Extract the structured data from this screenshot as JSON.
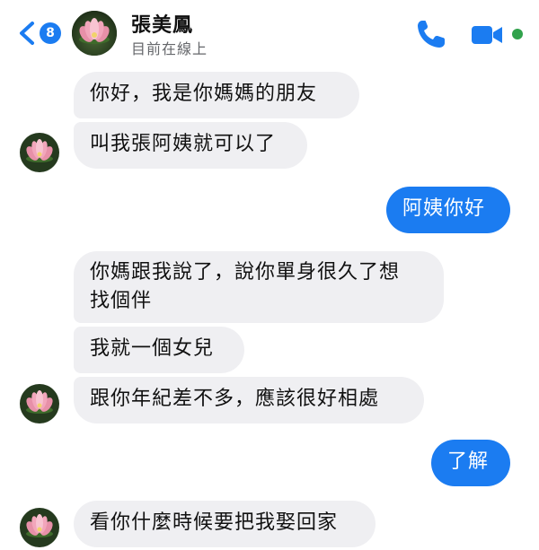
{
  "header": {
    "back_count": "8",
    "contact_name": "張美鳳",
    "status": "目前在線上"
  },
  "messages": [
    {
      "dir": "in",
      "text": "你好，我是你媽媽的朋友"
    },
    {
      "dir": "in",
      "text": "叫我張阿姨就可以了"
    },
    {
      "dir": "out",
      "text": "阿姨你好"
    },
    {
      "dir": "in",
      "text": "你媽跟我說了，說你單身很久了想\n找個伴"
    },
    {
      "dir": "in",
      "text": "我就一個女兒"
    },
    {
      "dir": "in",
      "text": "跟你年紀差不多，應該很好相處"
    },
    {
      "dir": "out",
      "text": "了解"
    },
    {
      "dir": "in",
      "text": "看你什麼時候要把我娶回家"
    }
  ],
  "colors": {
    "accent": "#1b7cf1",
    "incoming_bubble": "#efeff2",
    "online": "#31a24c"
  },
  "icons": [
    "back-chevron-icon",
    "phone-icon",
    "video-camera-icon",
    "lotus-avatar-icon"
  ]
}
